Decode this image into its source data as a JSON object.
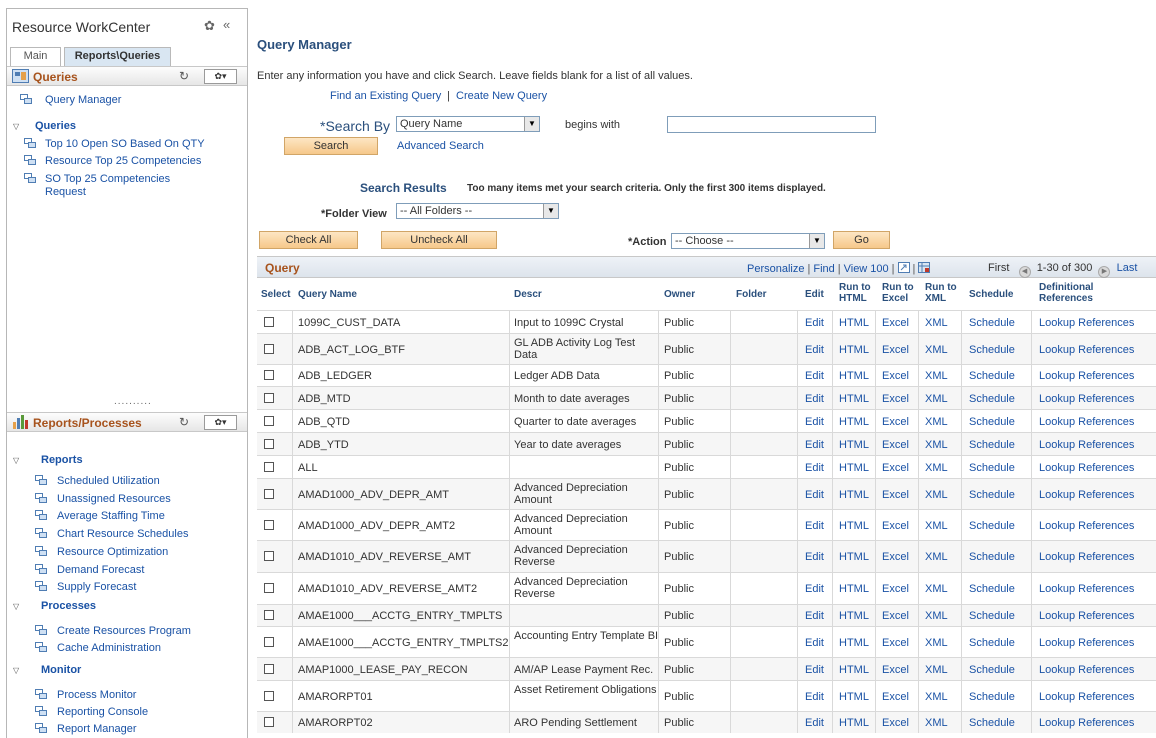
{
  "left_pane": {
    "title": "Resource WorkCenter",
    "gear_icon": "gear-icon",
    "collapse_glyph": "«",
    "tabs": [
      {
        "label": "Main"
      },
      {
        "label": "Reports\\Queries"
      }
    ],
    "queries_section": {
      "title": "Queries",
      "top_link": "Query Manager",
      "group": "Queries",
      "items": [
        {
          "label": "Top 10 Open SO Based On QTY"
        },
        {
          "label": "Resource Top 25 Competencies"
        },
        {
          "label": "SO Top 25 Competencies Request"
        }
      ]
    },
    "reports_section": {
      "title": "Reports/Processes",
      "groups": [
        {
          "label": "Reports",
          "items": [
            {
              "label": "Scheduled Utilization"
            },
            {
              "label": "Unassigned Resources"
            },
            {
              "label": "Average Staffing Time"
            },
            {
              "label": "Chart Resource Schedules"
            },
            {
              "label": "Resource Optimization"
            },
            {
              "label": "Demand Forecast"
            },
            {
              "label": "Supply Forecast"
            }
          ]
        },
        {
          "label": "Processes",
          "items": [
            {
              "label": "Create Resources Program"
            },
            {
              "label": "Cache Administration"
            }
          ]
        },
        {
          "label": "Monitor",
          "items": [
            {
              "label": "Process Monitor"
            },
            {
              "label": "Reporting Console"
            },
            {
              "label": "Report Manager"
            }
          ]
        }
      ]
    },
    "splitter_dots": "..........",
    "section_menu_glyph": "✿▾"
  },
  "main": {
    "title": "Query Manager",
    "instructions": "Enter any information you have and click Search. Leave fields blank for a list of all values.",
    "find_link": "Find an Existing Query",
    "separator": "|",
    "create_link": "Create New Query",
    "search_by_label": "*Search By",
    "search_by_value": "Query Name",
    "begins_with": "begins with",
    "search_text": "",
    "search_button": "Search",
    "advanced_search": "Advanced Search",
    "results_title": "Search Results",
    "results_msg": "Too many items met your search criteria. Only the first 300 items displayed.",
    "folder_view_label": "*Folder View",
    "folder_view_value": "-- All Folders --",
    "check_all": "Check All",
    "uncheck_all": "Uncheck All",
    "action_label": "*Action",
    "action_value": "-- Choose --",
    "go": "Go"
  },
  "grid": {
    "title": "Query",
    "personalize": "Personalize",
    "find": "Find",
    "view": "View 100",
    "first": "First",
    "range": "1-30 of 300",
    "last": "Last",
    "columns": {
      "select": "Select",
      "name": "Query Name",
      "descr": "Descr",
      "owner": "Owner",
      "folder": "Folder",
      "edit": "Edit",
      "html_1": "Run to",
      "html_2": "HTML",
      "excel_1": "Run to",
      "excel_2": "Excel",
      "xml_1": "Run to",
      "xml_2": "XML",
      "schedule": "Schedule",
      "refs_1": "Definitional",
      "refs_2": "References"
    },
    "link_labels": {
      "edit": "Edit",
      "html": "HTML",
      "excel": "Excel",
      "xml": "XML",
      "schedule": "Schedule",
      "refs": "Lookup References"
    },
    "rows": [
      {
        "name": "1099C_CUST_DATA",
        "descr": "Input to 1099C Crystal",
        "owner": "Public"
      },
      {
        "name": "ADB_ACT_LOG_BTF",
        "descr": "GL ADB Activity Log Test Data",
        "owner": "Public"
      },
      {
        "name": "ADB_LEDGER",
        "descr": "Ledger ADB Data",
        "owner": "Public"
      },
      {
        "name": "ADB_MTD",
        "descr": "Month to date averages",
        "owner": "Public"
      },
      {
        "name": "ADB_QTD",
        "descr": "Quarter to date averages",
        "owner": "Public"
      },
      {
        "name": "ADB_YTD",
        "descr": "Year to date averages",
        "owner": "Public"
      },
      {
        "name": "ALL",
        "descr": "",
        "owner": "Public"
      },
      {
        "name": "AMAD1000_ADV_DEPR_AMT",
        "descr": "Advanced Depreciation Amount",
        "owner": "Public"
      },
      {
        "name": "AMAD1000_ADV_DEPR_AMT2",
        "descr": "Advanced Depreciation Amount",
        "owner": "Public"
      },
      {
        "name": "AMAD1010_ADV_REVERSE_AMT",
        "descr": "Advanced Depreciation Reverse",
        "owner": "Public"
      },
      {
        "name": "AMAD1010_ADV_REVERSE_AMT2",
        "descr": "Advanced Depreciation Reverse",
        "owner": "Public"
      },
      {
        "name": "AMAE1000___ACCTG_ENTRY_TMPLTS",
        "descr": "",
        "owner": "Public"
      },
      {
        "name": "AMAE1000___ACCTG_ENTRY_TMPLTS2",
        "descr": "Accounting Entry Template BI",
        "owner": "Public"
      },
      {
        "name": "AMAP1000_LEASE_PAY_RECON",
        "descr": "AM/AP Lease Payment Rec.",
        "owner": "Public"
      },
      {
        "name": "AMARORPT01",
        "descr": "Asset Retirement Obligations",
        "owner": "Public"
      },
      {
        "name": "AMARORPT02",
        "descr": "ARO Pending Settlement",
        "owner": "Public"
      }
    ]
  },
  "colors": {
    "link": "#1a52a5",
    "section_title": "#a7531d",
    "heading": "#2a4f7c",
    "button": "#f6c88a"
  }
}
